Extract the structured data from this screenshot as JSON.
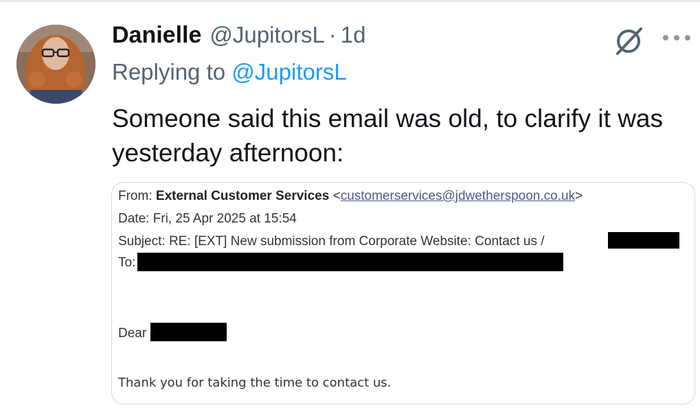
{
  "tweet": {
    "author_name": "Danielle",
    "author_handle": "@JupitorsL",
    "separator": "·",
    "time": "1d",
    "replying_prefix": "Replying to",
    "replying_handle": "@JupitorsL",
    "text": "Someone said this email was old, to clarify it was yesterday afternoon:"
  },
  "email": {
    "from_label": "From:",
    "from_name": "External Customer Services",
    "from_lt": "<",
    "from_address": "customerservices@jdwetherspoon.co.uk",
    "from_gt": ">",
    "date_label": "Date:",
    "date_value": "Fri, 25 Apr 2025 at 15:54",
    "subject_label": "Subject:",
    "subject_value": "RE: [EXT] New submission from Corporate Website: Contact us /",
    "to_label": "To:",
    "greeting": "Dear",
    "body": "Thank you for taking the time to contact us."
  },
  "icons": {
    "grok": "grok-icon",
    "more": "more-icon"
  },
  "colors": {
    "link": "#1d9bf0",
    "muted": "#536471"
  }
}
